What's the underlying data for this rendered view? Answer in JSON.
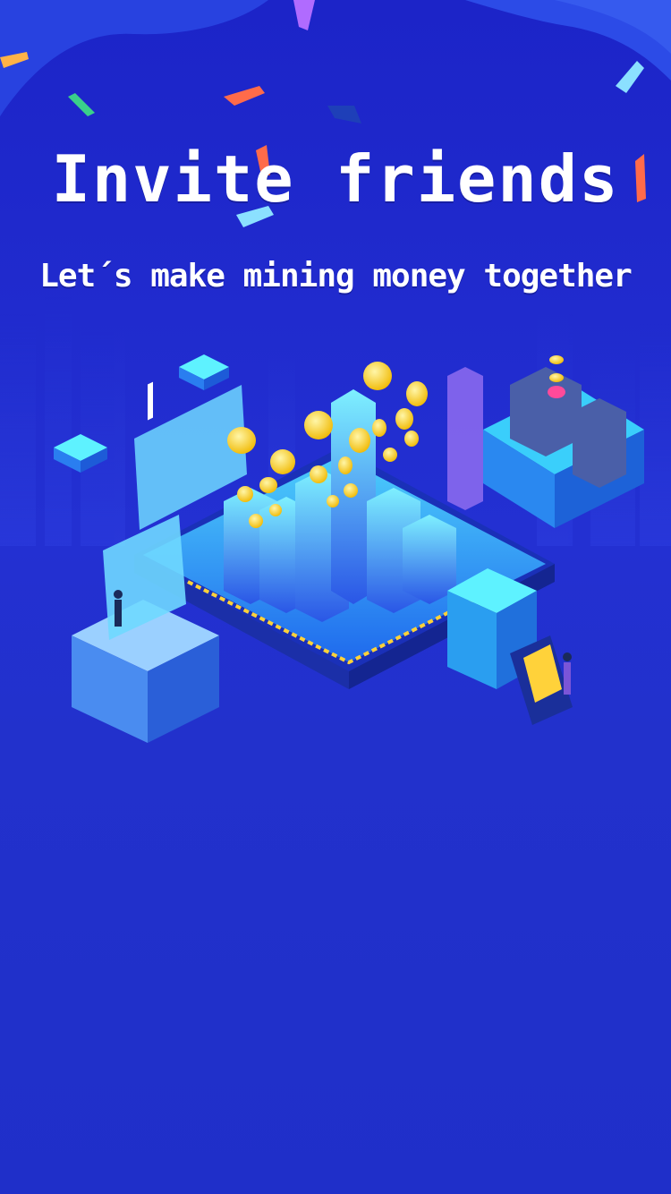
{
  "hero": {
    "title": "Invite friends",
    "subtitle": "Let´s make mining money together"
  },
  "colors": {
    "background": "#2230cc",
    "accent_cyan": "#3ee6ff",
    "coin_gold": "#ffd23a",
    "confetti_colors": [
      "#ff6b4a",
      "#b06bff",
      "#3ad08a",
      "#ffb347",
      "#8be0ff"
    ]
  },
  "illustration": {
    "icon": "isometric-mining-city-illustration"
  }
}
